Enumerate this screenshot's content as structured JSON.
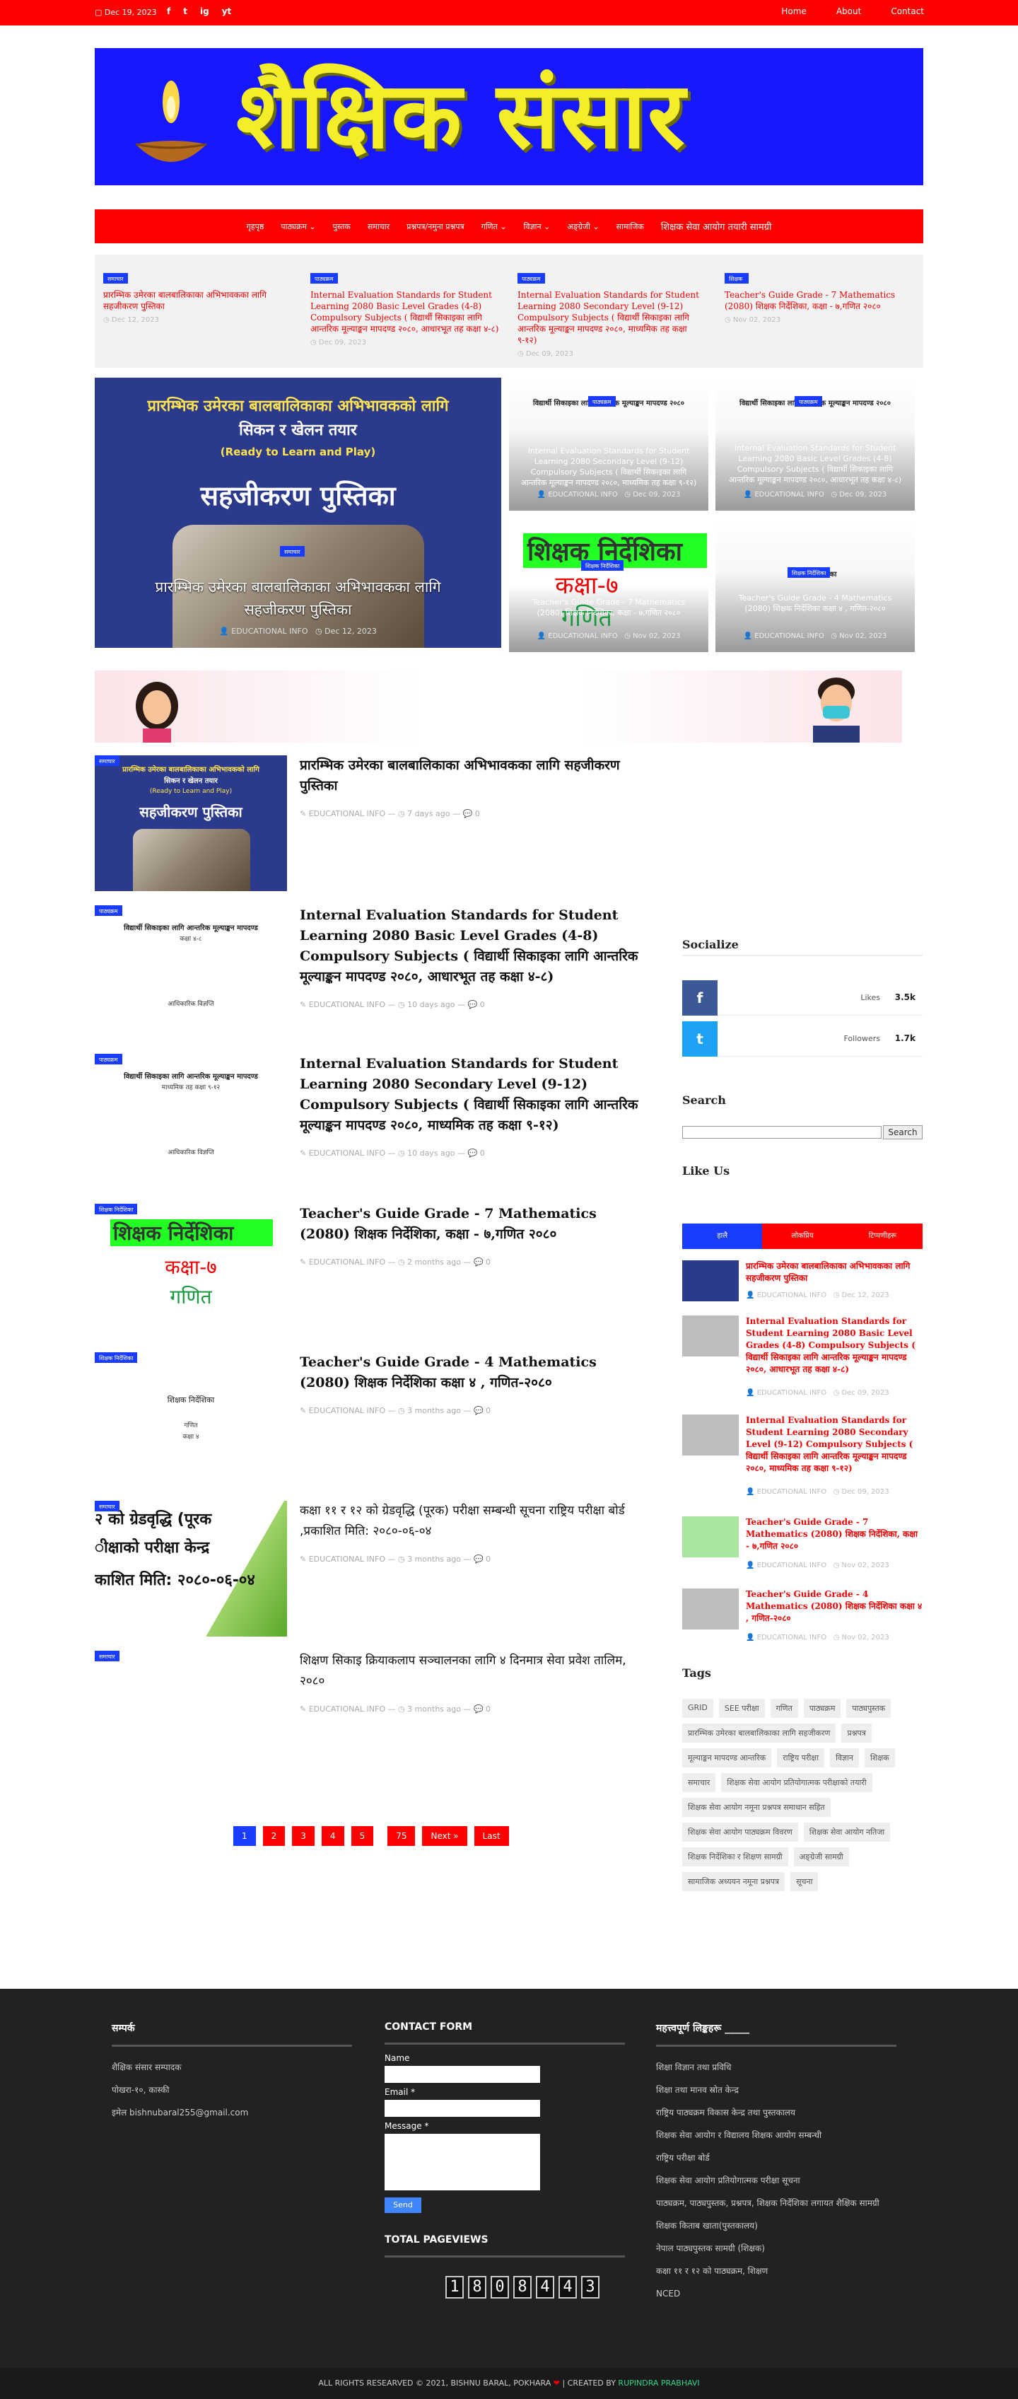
{
  "topbar": {
    "date": "Dec 19, 2023",
    "social": [
      "f",
      "t",
      "ig",
      "yt"
    ],
    "menu": [
      "Home",
      "About",
      "Contact"
    ]
  },
  "header": {
    "title": "शैक्षिक संसार"
  },
  "nav": {
    "items": [
      "गृहपृष्ठ",
      "पाठ्यक्रम ⌄",
      "पुस्तक",
      "समाचार",
      "प्रश्नपत्र/नमुना प्रश्नपत्र",
      "गणित ⌄",
      "विज्ञान ⌄",
      "अङ्ग्रेजी ⌄",
      "सामाजिक",
      "शिक्षक सेवा आयोग तयारी सामग्री"
    ]
  },
  "ticker": [
    {
      "badge": "समाचार",
      "title": "प्रारम्भिक उमेरका बालबालिकाका अभिभावकका लागि सहजीकरण पुस्तिका",
      "date": "Dec 12, 2023"
    },
    {
      "badge": "पाठ्यक्रम",
      "title": "Internal Evaluation Standards for Student Learning 2080 Basic Level Grades (4-8) Compulsory Subjects ( विद्यार्थी सिकाइका लागि आन्तरिक मूल्याङ्कन मापदण्ड २०८०, आधारभूत तह कक्षा ४-८)",
      "date": "Dec 09, 2023"
    },
    {
      "badge": "पाठ्यक्रम",
      "title": "Internal Evaluation Standards for Student Learning 2080 Secondary Level (9-12) Compulsory Subjects ( विद्यार्थी सिकाइका लागि आन्तरिक मूल्याङ्कन मापदण्ड २०८०, माध्यमिक तह कक्षा ९-१२)",
      "date": "Dec 09, 2023"
    },
    {
      "badge": "शिक्षक",
      "title": "Teacher's Guide Grade - 7 Mathematics (2080) शिक्षक निर्देशिका, कक्षा - ७,गणित २०८०",
      "date": "Nov 02, 2023"
    }
  ],
  "hero": {
    "main": {
      "h1": "प्रारम्भिक उमेरका बालबालिकाका अभिभावकको लागि",
      "h2": "सिकन र खेलन तयार",
      "h3": "(Ready to Learn and Play)",
      "h4": "सहजीकरण पुस्तिका",
      "badge": "समाचार",
      "caption": "प्रारम्भिक उमेरका बालबालिकाका अभिभावकका लागि सहजीकरण पुस्तिका",
      "author": "EDUCATIONAL INFO",
      "date": "Dec 12, 2023"
    },
    "small": [
      {
        "doc": "विद्यार्थी सिकाइका लागि आन्तरिक मूल्याङ्कन मापदण्ड २०८०",
        "badge": "पाठ्यक्रम",
        "caption": "Internal Evaluation Standards for Student Learning 2080 Secondary Level (9-12) Compulsory Subjects ( विद्यार्थी सिकाइका लागि आन्तरिक मूल्याङ्कन मापदण्ड २०८०, माध्यमिक तह कक्षा ९-१२)",
        "author": "EDUCATIONAL INFO",
        "date": "Dec 09, 2023"
      },
      {
        "doc": "विद्यार्थी सिकाइका लागि आन्तरिक मूल्याङ्कन मापदण्ड २०८०",
        "badge": "पाठ्यक्रम",
        "caption": "Internal Evaluation Standards for Student Learning 2080 Basic Level Grades (4-8) Compulsory Subjects ( विद्यार्थी सिकाइका लागि आन्तरिक मूल्याङ्कन मापदण्ड २०८०, आधारभूत तह कक्षा ४-८)",
        "author": "EDUCATIONAL INFO",
        "date": "Dec 09, 2023"
      },
      {
        "cover1": "शिक्षक निर्देशिका",
        "cover2": "कक्षा-७",
        "cover3": "गणित",
        "badge": "शिक्षक निर्देशिका",
        "caption": "Teacher's Guide Grade - 7 Mathematics (2080) शिक्षक निर्देशिका, कक्षा - ७,गणित २०८०",
        "author": "EDUCATIONAL INFO",
        "date": "Nov 02, 2023"
      },
      {
        "doc": "शिक्षक निर्देशिका",
        "badge": "शिक्षक निर्देशिका",
        "caption": "Teacher's Guide Grade - 4 Mathematics (2080) शिक्षक निर्देशिका कक्षा ४ , गणित-२०८०",
        "author": "EDUCATIONAL INFO",
        "date": "Nov 02, 2023"
      }
    ]
  },
  "posts": [
    {
      "badge": "समाचार",
      "title": "प्रारम्भिक उमेरका बालबालिकाका अभिभावकका लागि सहजीकरण पुस्तिका",
      "author": "EDUCATIONAL INFO",
      "ago": "7 days ago",
      "comments": "0"
    },
    {
      "badge": "पाठ्यक्रम",
      "title": "Internal Evaluation Standards for Student Learning 2080 Basic Level Grades (4-8) Compulsory Subjects ( विद्यार्थी सिकाइका लागि आन्तरिक मूल्याङ्कन मापदण्ड २०८०, आधारभूत तह कक्षा ४-८)",
      "author": "EDUCATIONAL INFO",
      "ago": "10 days ago",
      "comments": "0"
    },
    {
      "badge": "पाठ्यक्रम",
      "title": "Internal Evaluation Standards for Student Learning 2080 Secondary Level (9-12) Compulsory Subjects ( विद्यार्थी सिकाइका लागि आन्तरिक मूल्याङ्कन मापदण्ड २०८०, माध्यमिक तह कक्षा ९-१२)",
      "author": "EDUCATIONAL INFO",
      "ago": "10 days ago",
      "comments": "0"
    },
    {
      "badge": "शिक्षक निर्देशिका",
      "title": "Teacher's Guide Grade - 7 Mathematics (2080) शिक्षक निर्देशिका, कक्षा - ७,गणित २०८०",
      "author": "EDUCATIONAL INFO",
      "ago": "2 months ago",
      "comments": "0"
    },
    {
      "badge": "शिक्षक निर्देशिका",
      "title": "Teacher's Guide Grade - 4 Mathematics (2080) शिक्षक निर्देशिका कक्षा ४ , गणित-२०८०",
      "author": "EDUCATIONAL INFO",
      "ago": "3 months ago",
      "comments": "0"
    },
    {
      "badge": "समाचार",
      "title": "कक्षा ११ र १२ को ग्रेडवृद्धि (पूरक) परीक्षा सम्बन्धी सूचना राष्ट्रिय परीक्षा बोर्ड ,प्रकाशित मिति: २०८०-०६-०४",
      "author": "EDUCATIONAL INFO",
      "ago": "3 months ago",
      "comments": "0"
    },
    {
      "badge": "समाचार",
      "title": "शिक्षण सिकाइ क्रियाकलाप सञ्चालनका लागि ४ दिनमात्र सेवा प्रवेश तालिम, २०८०",
      "author": "EDUCATIONAL INFO",
      "ago": "3 months ago",
      "comments": "0"
    }
  ],
  "post_thumbs": {
    "p1_h1": "प्रारम्भिक उमेरका बालबालिकाका अभिभावकको लागि",
    "p1_h2": "सिकन र खेलन तयार",
    "p1_h3": "(Ready to Learn and Play)",
    "p1_h4": "सहजीकरण पुस्तिका",
    "doc_l1": "विद्यार्थी सिकाइका लागि आन्तरिक मूल्याङ्कन मापदण्ड",
    "doc_l2": "आधारभूत २०८०",
    "doc_l2b": "कक्षा ४-८",
    "doc_l3": "आधिकारिक विज्ञप्ति",
    "doc_sec2": "माध्यमिक तह कक्षा ९-१२",
    "p4_c1": "शिक्षक निर्देशिका",
    "p4_c2": "कक्षा-७",
    "p4_c3": "गणित",
    "p5_l1": "शिक्षक निर्देशिका",
    "p5_l2": "गणित",
    "p5_l3": "कक्षा ४",
    "p6_l1": "२ को ग्रेडवृद्धि (पूरक",
    "p6_l2": "ीक्षाको परीक्षा केन्द्र",
    "p6_l3": "काशित मिति: २०८०-०६-०४"
  },
  "pagination": [
    "1",
    "2",
    "3",
    "4",
    "5",
    "75",
    "Next »",
    "Last"
  ],
  "sidebar": {
    "socialize_title": "Socialize",
    "facebook": {
      "icon": "f",
      "label": "Likes",
      "count": "3.5k"
    },
    "twitter": {
      "icon": "t",
      "label": "Followers",
      "count": "1.7k"
    },
    "search_title": "Search",
    "search_button": "Search",
    "likeus_title": "Like Us",
    "tabs": [
      "हालै",
      "लोकप्रिय",
      "टिप्पणीहरू"
    ],
    "recent": [
      {
        "title": "प्रारम्भिक उमेरका बालबालिकाका अभिभावकका लागि सहजीकरण पुस्तिका",
        "author": "EDUCATIONAL INFO",
        "date": "Dec 12, 2023"
      },
      {
        "title": "Internal Evaluation Standards for Student Learning 2080 Basic Level Grades (4-8) Compulsory Subjects ( विद्यार्थी सिकाइका लागि आन्तरिक मूल्याङ्कन मापदण्ड २०८०, आधारभूत तह कक्षा ४-८)",
        "author": "EDUCATIONAL INFO",
        "date": "Dec 09, 2023"
      },
      {
        "title": "Internal Evaluation Standards for Student Learning 2080 Secondary Level (9-12) Compulsory Subjects ( विद्यार्थी सिकाइका लागि आन्तरिक मूल्याङ्कन मापदण्ड २०८०, माध्यमिक तह कक्षा ९-१२)",
        "author": "EDUCATIONAL INFO",
        "date": "Dec 09, 2023"
      },
      {
        "title": "Teacher's Guide Grade - 7 Mathematics (2080) शिक्षक निर्देशिका, कक्षा - ७,गणित २०८०",
        "author": "EDUCATIONAL INFO",
        "date": "Nov 02, 2023"
      },
      {
        "title": "Teacher's Guide Grade - 4 Mathematics (2080) शिक्षक निर्देशिका कक्षा ४ , गणित-२०८०",
        "author": "EDUCATIONAL INFO",
        "date": "Nov 02, 2023"
      }
    ],
    "tags_title": "Tags",
    "tags": [
      "GRID",
      "SEE परीक्षा",
      "गणित",
      "पाठ्यक्रम",
      "पाठ्यपुस्तक",
      "प्रारम्भिक उमेरका बालबालिकाका लागि सहजीकरण",
      "प्रश्नपत्र",
      "मूल्याङ्कन मापदण्ड आन्तरिक",
      "राष्ट्रिय परीक्षा",
      "विज्ञान",
      "शिक्षक",
      "समाचार",
      "शिक्षक सेवा आयोग प्रतियोगात्मक परीक्षाको तयारी",
      "शिक्षक सेवा आयोग नमूना प्रश्नपत्र समाधान सहित",
      "शिक्षक सेवा आयोग पाठ्यक्रम विवरण",
      "शिक्षक सेवा आयोग नतिजा",
      "शिक्षक निर्देशिका र शिक्षण सामग्री",
      "अङ्ग्रेजी सामग्री",
      "सामाजिक अध्ययन नमूना प्रश्नपत्र",
      "सूचना"
    ]
  },
  "footer": {
    "about_title": "सम्पर्क",
    "about_lines": [
      "शैक्षिक संसार सम्पादक",
      "पोखरा-१०, कास्की",
      "इमेल bishnubaral255@gmail.com"
    ],
    "contact_title": "CONTACT FORM",
    "name_label": "Name",
    "email_label": "Email *",
    "message_label": "Message *",
    "send_label": "Send",
    "pageviews_title": "TOTAL PAGEVIEWS",
    "pageviews_digits": [
      "1",
      "8",
      "0",
      "8",
      "4",
      "4",
      "3"
    ],
    "links_title": "महत्त्वपूर्ण लिङ्कहरू _____",
    "links": [
      "शिक्षा विज्ञान तथा प्रविधि",
      "शिक्षा तथा मानव स्रोत केन्द्र",
      "राष्ट्रिय पाठ्यक्रम विकास केन्द्र तथा पुस्तकालय",
      "शिक्षक सेवा आयोग र विद्यालय शिक्षक आयोग सम्बन्धी",
      "राष्ट्रिय परीक्षा बोर्ड",
      "शिक्षक सेवा आयोग प्रतियोगात्मक परीक्षा सूचना",
      "पाठ्यक्रम, पाठ्यपुस्तक, प्रश्नपत्र, शिक्षक निर्देशिका लगायत शैक्षिक सामग्री",
      "शिक्षक किताब खाता(पुस्तकालय)",
      "नेपाल पाठ्यपुस्तक सामग्री (शिक्षक)",
      "कक्षा ११ र १२ को पाठ्यक्रम, शिक्षण",
      "NCED"
    ]
  },
  "copyright": {
    "text": "ALL RIGHTS RESEARVED © 2021, BISHNU BARAL, POKHARA",
    "heart": "❤",
    "created_by": "| CREATED BY",
    "creator": "RUPINDRA PRABHAVI"
  },
  "colors": {
    "primary": "#ff0000",
    "accent": "#1a3cff",
    "facebook": "#3b5998",
    "twitter": "#1da1f2",
    "footer": "#222222"
  }
}
